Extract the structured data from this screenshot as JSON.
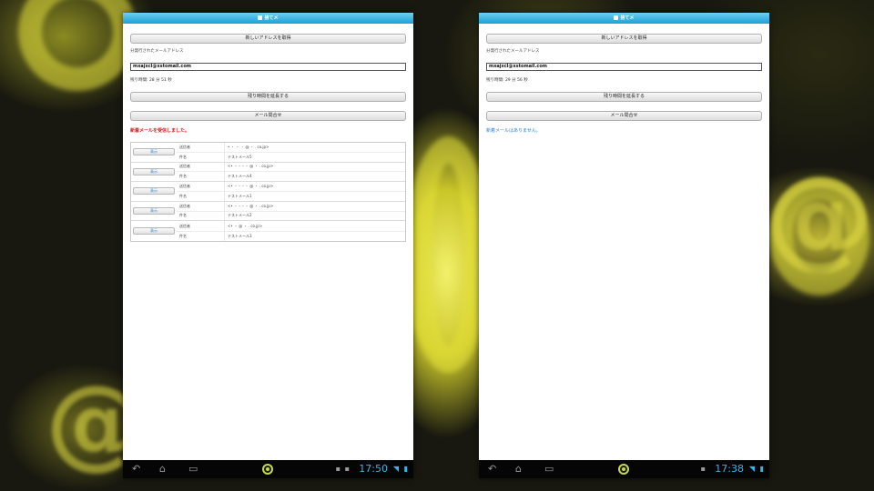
{
  "left_screen": {
    "app_title": "捨てメ",
    "new_address_button": "新しいアドレスを取得",
    "issued_email_label": "分発行されたメールアドレス",
    "email_value": "mxajxcl@xstomail.com",
    "remaining_time": "残り時間: 28 分 51 秒",
    "extend_button": "残り時間を延長する",
    "check_mail_button": "メール問合せ",
    "status_message": "新着メールを受信しました。",
    "messages": [
      {
        "view_label": "表示",
        "from_label": "送信者",
        "from_value": "• ・ ・ ・ @ ・ . co.jp>",
        "subject_label": "件名",
        "subject_value": "テストメール5"
      },
      {
        "view_label": "表示",
        "from_label": "送信者",
        "from_value": "<• ・・・・ @ ・ . co.jp>",
        "subject_label": "件名",
        "subject_value": "テストメール4"
      },
      {
        "view_label": "表示",
        "from_label": "送信者",
        "from_value": "<• ・・・・ @ ・ . co.jp>",
        "subject_label": "件名",
        "subject_value": "テストメール1"
      },
      {
        "view_label": "表示",
        "from_label": "送信者",
        "from_value": "<• ・・・・ @ ・ . co.jp>",
        "subject_label": "件名",
        "subject_value": "テストメール2"
      },
      {
        "view_label": "表示",
        "from_label": "送信者",
        "from_value": "<• ・ @ ・ . co.jp>",
        "subject_label": "件名",
        "subject_value": "テストメール3"
      }
    ],
    "status_bar_time": "17:50"
  },
  "right_screen": {
    "app_title": "捨てメ",
    "new_address_button": "新しいアドレスを取得",
    "issued_email_label": "分発行されたメールアドレス",
    "email_value": "mxajxcl@xstomail.com",
    "remaining_time": "残り時間: 29 分 56 秒",
    "extend_button": "残り時間を延長する",
    "check_mail_button": "メール問合せ",
    "status_message": "新着メールはありません。",
    "status_bar_time": "17:38"
  },
  "icons": {
    "back": "back-icon",
    "home": "home-icon",
    "recent": "recent-apps-icon",
    "launcher": "launcher-icon",
    "wifi": "wifi-icon",
    "battery": "battery-icon"
  },
  "colors": {
    "title_bar": "#1aa0d8",
    "status_red": "#d21a1a",
    "status_blue": "#2f7fd0",
    "clock": "#3ab4e6"
  }
}
